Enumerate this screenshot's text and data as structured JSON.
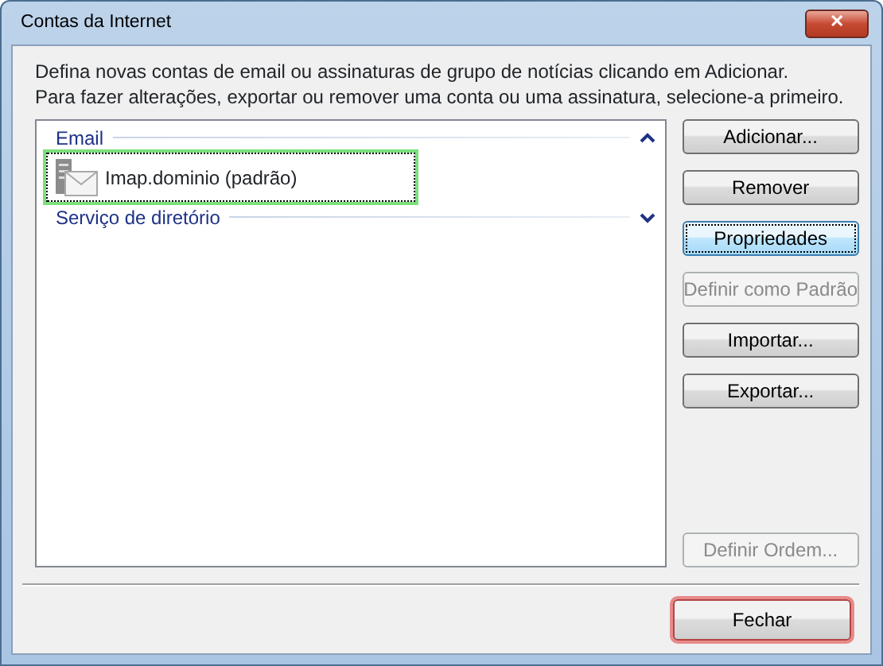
{
  "window": {
    "title": "Contas da Internet",
    "close": "✕"
  },
  "instructions": [
    "Defina novas contas de email ou assinaturas de grupo de notícias clicando em Adicionar.",
    "Para fazer alterações, exportar ou remover uma conta ou uma assinatura, selecione-a primeiro."
  ],
  "groups": [
    {
      "label": "Email",
      "expanded": true,
      "items": [
        {
          "label": "Imap.dominio (padrão)",
          "selected": true
        }
      ]
    },
    {
      "label": "Serviço de diretório",
      "expanded": false
    }
  ],
  "buttons": [
    {
      "label": "Adicionar...",
      "disabled": false,
      "focused": false
    },
    {
      "label": "Remover",
      "disabled": false,
      "focused": false
    },
    {
      "label": "Propriedades",
      "disabled": false,
      "focused": true
    },
    {
      "label": "Definir como Padrão",
      "disabled": true,
      "focused": false
    },
    {
      "label": "Importar...",
      "disabled": false,
      "focused": false
    },
    {
      "label": "Exportar...",
      "disabled": false,
      "focused": false
    },
    {
      "kind": "spacer"
    },
    {
      "label": "Definir Ordem...",
      "disabled": true,
      "focused": false
    }
  ],
  "footer_button": {
    "label": "Fechar",
    "highlighted": true
  }
}
